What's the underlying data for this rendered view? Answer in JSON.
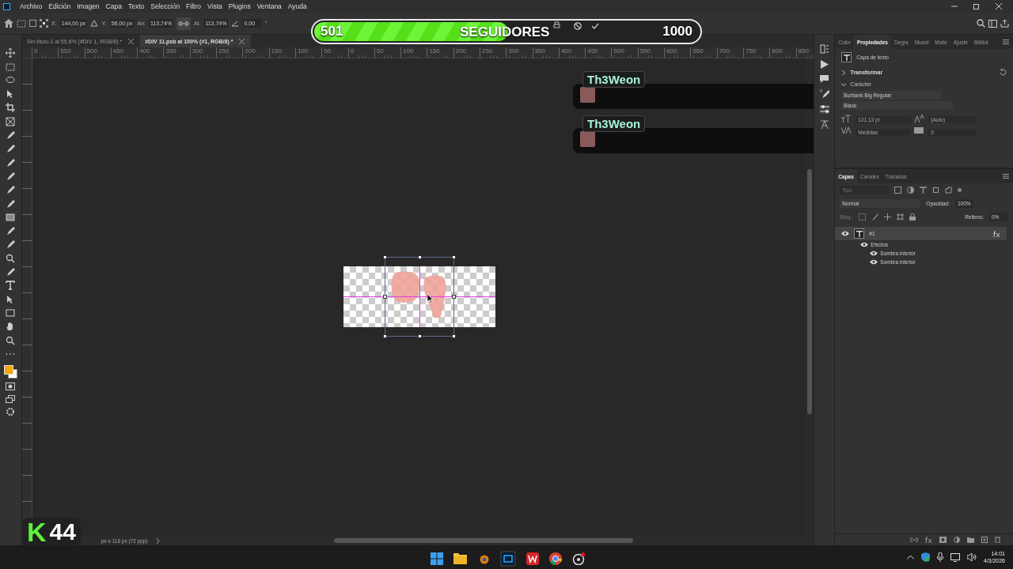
{
  "menu_bar": {
    "items": [
      "Archivo",
      "Edición",
      "Imagen",
      "Capa",
      "Texto",
      "Selección",
      "Filtro",
      "Vista",
      "Plugins",
      "Ventana",
      "Ayuda"
    ]
  },
  "options_bar": {
    "fields": [
      {
        "label": "X:",
        "value": "144,00 px"
      },
      {
        "label": "Y:",
        "value": "58,00 px"
      },
      {
        "label": "An:",
        "value": "113,74%"
      },
      {
        "label": "Al:",
        "value": "113,74%"
      }
    ],
    "angle": {
      "value": "0,00",
      "unit": "°"
    }
  },
  "document_tabs": [
    {
      "label": "Sin título-1 al 55,6% (#DIV 1, RGB/8) *",
      "selected": false
    },
    {
      "label": "#DIV 11.psb al 100% (#1, RGB/8) *",
      "selected": true
    }
  ],
  "ruler_labels": [
    "0",
    "550",
    "500",
    "450",
    "400",
    "350",
    "300",
    "250",
    "200",
    "150",
    "100",
    "50",
    "0",
    "50",
    "100",
    "150",
    "200",
    "250",
    "300",
    "350",
    "400",
    "450",
    "500",
    "550",
    "600",
    "650",
    "700",
    "750",
    "800",
    "850"
  ],
  "follower_goal": {
    "current": "501",
    "label": "SEGUIDORES",
    "target": "1000",
    "level": 0.5
  },
  "chat_messages": [
    {
      "username": "Th3Weon"
    },
    {
      "username": "Th3Weon"
    }
  ],
  "properties_panel": {
    "tabs": [
      {
        "label": "Color",
        "selected": false
      },
      {
        "label": "Propiedades",
        "selected": true
      },
      {
        "label": "Degra",
        "selected": false
      },
      {
        "label": "Muest",
        "selected": false
      },
      {
        "label": "Motiv",
        "selected": false
      },
      {
        "label": "Ajuste",
        "selected": false
      },
      {
        "label": "Bibliot",
        "selected": false
      }
    ],
    "layer_type": "Capa de texto",
    "sections": [
      {
        "label": "Transformar",
        "expanded": false
      },
      {
        "label": "Carácter",
        "expanded": true
      }
    ],
    "font_family": "Burbank Big Regular",
    "font_style": "Black",
    "font_size": "121,13 pt",
    "leading": "(Auto)",
    "kerning": "Medidas",
    "tracking": "0"
  },
  "layers_panel": {
    "tabs": [
      {
        "label": "Capas",
        "selected": true
      },
      {
        "label": "Canales",
        "selected": false
      },
      {
        "label": "Trazados",
        "selected": false
      }
    ],
    "search_placeholder": "Tipo",
    "blend_mode": "Normal",
    "opacity_label": "Opacidad:",
    "opacity": "100%",
    "lock_label": "Bloq.:",
    "fill_label": "Relleno:",
    "fill": "0%",
    "layers": [
      {
        "name": "#1",
        "visible": true,
        "selected": true,
        "children": [
          {
            "name": "Efectos",
            "visible": true,
            "children": [
              {
                "name": "Sombra interior",
                "visible": true
              },
              {
                "name": "Sombra interior",
                "visible": true
              }
            ]
          }
        ]
      }
    ]
  },
  "status_bar": {
    "document_info": "px x 116 px (72 ppp)"
  },
  "stream_logo": {
    "letter": "K",
    "number": "44"
  },
  "taskbar": {
    "time": "14:01",
    "date": "4/3/2026"
  }
}
